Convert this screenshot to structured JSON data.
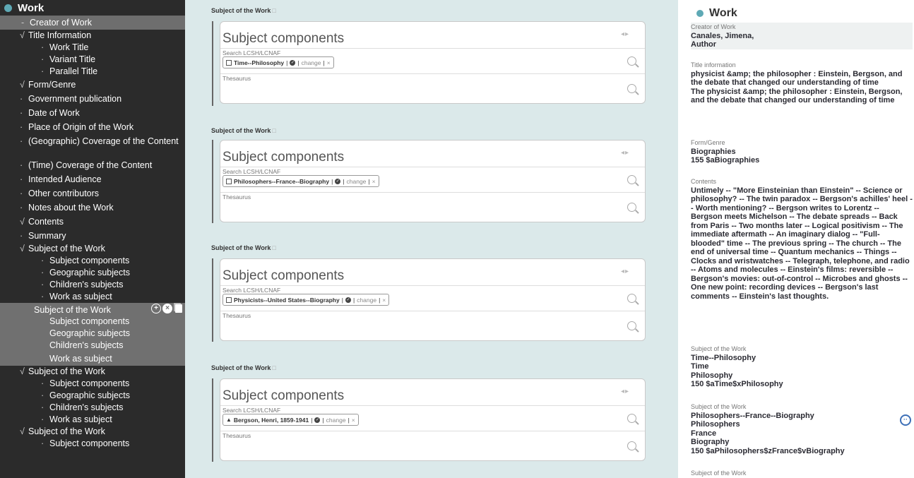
{
  "sidebar": {
    "title": "Work",
    "items": [
      {
        "mark": "-",
        "label": "Creator of Work",
        "indent": 0,
        "active": true
      },
      {
        "mark": "√",
        "label": "Title Information",
        "indent": 0
      },
      {
        "mark": "·",
        "label": "Work Title",
        "indent": 1
      },
      {
        "mark": "·",
        "label": "Variant Title",
        "indent": 1
      },
      {
        "mark": "·",
        "label": "Parallel Title",
        "indent": 1
      },
      {
        "mark": "√",
        "label": "Form/Genre",
        "indent": 0
      },
      {
        "mark": "·",
        "label": "Government publication",
        "indent": 0
      },
      {
        "mark": "·",
        "label": "Date of Work",
        "indent": 0
      },
      {
        "mark": "·",
        "label": "Place of Origin of the Work",
        "indent": 0
      },
      {
        "mark": "·",
        "label": "(Geographic) Coverage of the Content",
        "indent": 0,
        "wrap": true
      },
      {
        "mark": "·",
        "label": "(Time) Coverage of the Content",
        "indent": 0
      },
      {
        "mark": "·",
        "label": "Intended Audience",
        "indent": 0
      },
      {
        "mark": "·",
        "label": "Other contributors",
        "indent": 0
      },
      {
        "mark": "·",
        "label": "Notes about the Work",
        "indent": 0
      },
      {
        "mark": "√",
        "label": "Contents",
        "indent": 0
      },
      {
        "mark": "·",
        "label": "Summary",
        "indent": 0
      },
      {
        "mark": "√",
        "label": "Subject of the Work",
        "indent": 0
      },
      {
        "mark": "·",
        "label": "Subject components",
        "indent": 1
      },
      {
        "mark": "·",
        "label": "Geographic subjects",
        "indent": 1
      },
      {
        "mark": "·",
        "label": "Children's subjects",
        "indent": 1
      },
      {
        "mark": "·",
        "label": "Work as subject",
        "indent": 1
      },
      {
        "mark": "",
        "label": "Subject of the Work",
        "indent": 0,
        "block": true,
        "actions": true
      },
      {
        "mark": "",
        "label": "Subject components",
        "indent": 1,
        "block": true
      },
      {
        "mark": "",
        "label": "Geographic subjects",
        "indent": 1,
        "block": true
      },
      {
        "mark": "",
        "label": "Children's subjects",
        "indent": 1,
        "block": true
      },
      {
        "mark": "",
        "label": "Work as subject",
        "indent": 1,
        "block": true
      },
      {
        "mark": "√",
        "label": "Subject of the Work",
        "indent": 0
      },
      {
        "mark": "·",
        "label": "Subject components",
        "indent": 1
      },
      {
        "mark": "·",
        "label": "Geographic subjects",
        "indent": 1
      },
      {
        "mark": "·",
        "label": "Children's subjects",
        "indent": 1
      },
      {
        "mark": "·",
        "label": "Work as subject",
        "indent": 1
      },
      {
        "mark": "√",
        "label": "Subject of the Work",
        "indent": 0
      },
      {
        "mark": "·",
        "label": "Subject components",
        "indent": 1
      }
    ]
  },
  "middle": {
    "sections": [
      {
        "title": "Subject of the Work",
        "card_title": "Subject components",
        "search_label": "Search LCSH/LCNAF",
        "thesaurus_label": "Thesaurus",
        "pill_icon": "book-icon",
        "pill_text": "Time--Philosophy",
        "change_label": "change"
      },
      {
        "title": "Subject of the Work",
        "card_title": "Subject components",
        "search_label": "Search LCSH/LCNAF",
        "thesaurus_label": "Thesaurus",
        "pill_icon": "book-icon",
        "pill_text": "Philosophers--France--Biography",
        "change_label": "change"
      },
      {
        "title": "Subject of the Work",
        "card_title": "Subject components",
        "search_label": "Search LCSH/LCNAF",
        "thesaurus_label": "Thesaurus",
        "pill_icon": "book-icon",
        "pill_text": "Physicists--United States--Biography",
        "change_label": "change"
      },
      {
        "title": "Subject of the Work",
        "card_title": "Subject components",
        "search_label": "Search LCSH/LCNAF",
        "thesaurus_label": "Thesaurus",
        "pill_icon": "person-icon",
        "pill_text": "Bergson, Henri, 1859-1941",
        "change_label": "change"
      }
    ]
  },
  "right": {
    "title": "Work",
    "blocks": [
      {
        "label": "Creator of Work",
        "lines": [
          "Canales, Jimena,",
          "Author"
        ],
        "shade": true
      },
      {
        "label": "Title information",
        "lines": [
          "physicist &amp; the philosopher : Einstein, Bergson, and the debate that changed our understanding of time",
          "The physicist &amp; the philosopher : Einstein, Bergson, and the debate that changed our understanding of time"
        ]
      },
      {
        "label": "Form/Genre",
        "lines": [
          "Biographies",
          "155 $aBiographies"
        ]
      },
      {
        "label": "Contents",
        "lines": [
          "Untimely -- \"More Einsteinian than Einstein\" -- Science or philosophy? -- The twin paradox -- Bergson's achilles' heel -- Worth mentioning? -- Bergson writes to Lorentz -- Bergson meets Michelson -- The debate spreads -- Back from Paris -- Two months later -- Logical positivism -- The immediate aftermath -- An imaginary dialog -- \"Full-blooded\" time -- The previous spring -- The church -- The end of universal time -- Quantum mechanics -- Things -- Clocks and wristwatches -- Telegraph, telephone, and radio -- Atoms and molecules -- Einstein's films: reversible -- Bergson's movies: out-of-control -- Microbes and ghosts -- One new point: recording devices -- Bergson's last comments -- Einstein's last thoughts."
        ]
      },
      {
        "label": "Subject of the Work",
        "lines": [
          "Time--Philosophy",
          "Time",
          "Philosophy",
          "150 $aTime$xPhilosophy"
        ]
      },
      {
        "label": "Subject of the Work",
        "lines": [
          "Philosophers--France--Biography",
          "Philosophers",
          "France",
          "Biography",
          "150 $aPhilosophers$zFrance$vBiography"
        ]
      },
      {
        "label": "Subject of the Work",
        "lines": []
      }
    ]
  },
  "colors": {
    "sidebar_bg": "#2b2b2b",
    "sidebar_active": "#6e6e6e",
    "middle_bg": "#dbe9ea",
    "accent_dot": "#5ea9b5",
    "scroll_button": "#3c6fb7"
  }
}
